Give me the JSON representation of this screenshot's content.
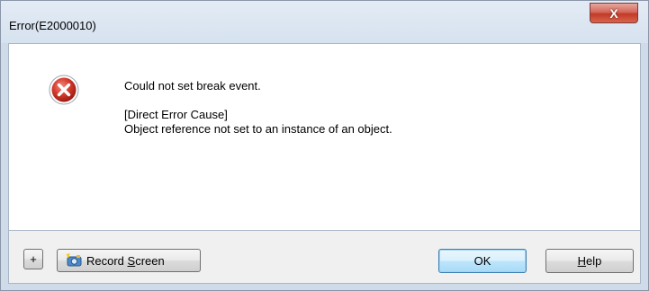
{
  "window": {
    "title": "Error(E2000010)",
    "close_symbol": "X"
  },
  "message": {
    "line1": "Could not set break event.",
    "line2": "[Direct Error Cause]",
    "line3": "Object reference not set to an instance of an object."
  },
  "buttons": {
    "expand": "+",
    "record_prefix": "Record ",
    "record_mnemonic": "S",
    "record_suffix": "creen",
    "ok": "OK",
    "help_mnemonic": "H",
    "help_suffix": "elp"
  },
  "icons": {
    "error": "error-icon",
    "camera": "camera-icon"
  },
  "colors": {
    "title_bg": "#d6e2ef",
    "close_red": "#c23a27",
    "error_red": "#c62a2a"
  }
}
